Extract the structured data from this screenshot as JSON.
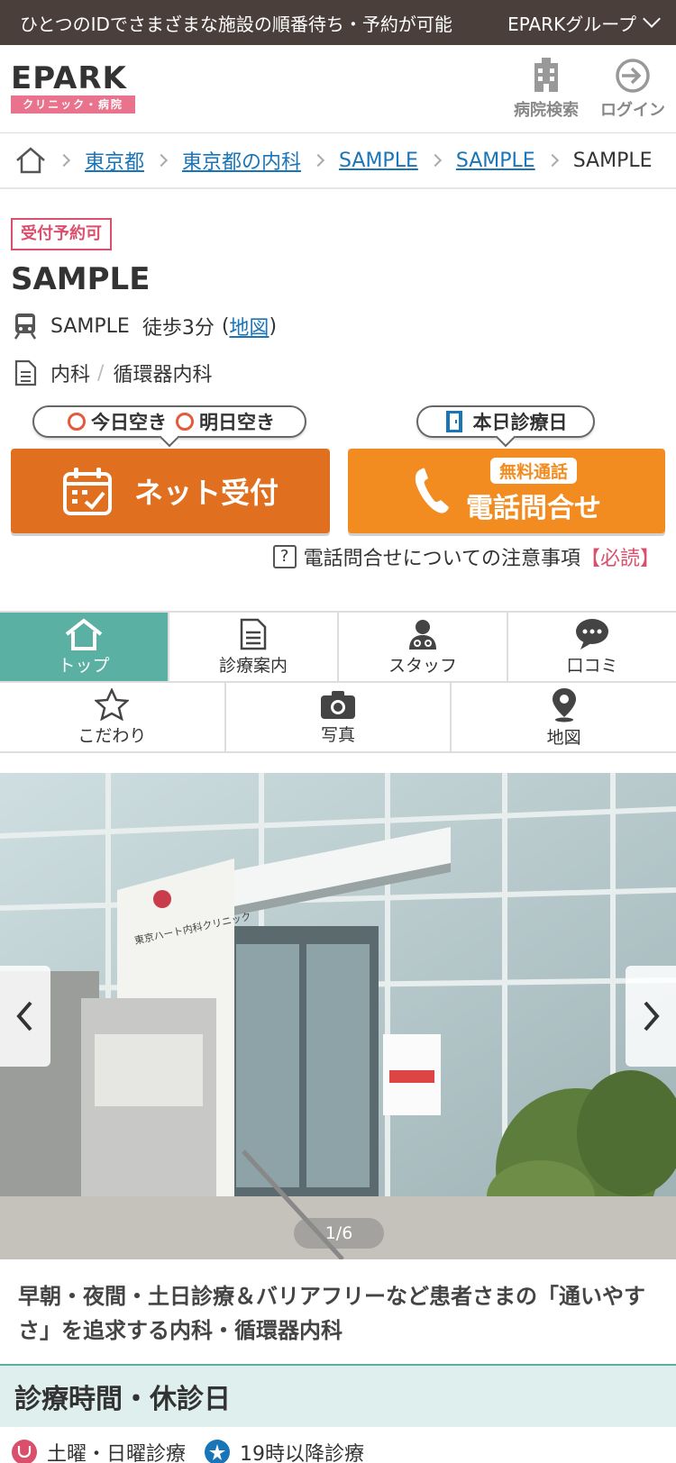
{
  "topbar": {
    "tagline": "ひとつのIDでさまざまな施設の順番待ち・予約が可能",
    "group_label": "EPARKグループ"
  },
  "header": {
    "logo_text": "EPARK",
    "logo_sub": "クリニック・病院",
    "hospital_search_label": "病院検索",
    "login_label": "ログイン"
  },
  "breadcrumb": {
    "items": [
      "東京都",
      "東京都の内科",
      "SAMPLE",
      "SAMPLE"
    ],
    "current": "SAMPLE"
  },
  "clinic": {
    "badge": "受付予約可",
    "name": "SAMPLE",
    "station": "SAMPLE",
    "walk": "徒歩3分",
    "map_open": "(",
    "map_link": "地図",
    "map_close": ")",
    "department_1": "内科",
    "department_sep": "/",
    "department_2": "循環器内科"
  },
  "cta": {
    "availability_today": "今日空き",
    "availability_tomorrow": "明日空き",
    "clinic_day": "本日診療日",
    "net_label": "ネット受付",
    "tel_free": "無料通話",
    "tel_label": "電話問合せ",
    "notice_qmark": "?",
    "notice_text": "電話問合せについての注意事項",
    "notice_must": "【必読】"
  },
  "tabs": {
    "top": "トップ",
    "guide": "診療案内",
    "staff": "スタッフ",
    "reviews": "口コミ",
    "features": "こだわり",
    "photos": "写真",
    "map": "地図"
  },
  "gallery": {
    "pager": "1/6",
    "sign_text": "東京ハート内科クリニック"
  },
  "catch_copy": "早朝・夜間・土日診療＆バリアフリーなど患者さまの「通いやすさ」を追求する内科・循環器内科",
  "section": {
    "hours_title": "診療時間・休診日",
    "chip_weekend": "土曜・日曜診療",
    "chip_night": "19時以降診療"
  },
  "colors": {
    "accent_teal": "#5bb0a4",
    "cta_net": "#e0701f",
    "cta_tel": "#f28c20",
    "badge_pink": "#d94f6c",
    "link_blue": "#1a75b8"
  }
}
